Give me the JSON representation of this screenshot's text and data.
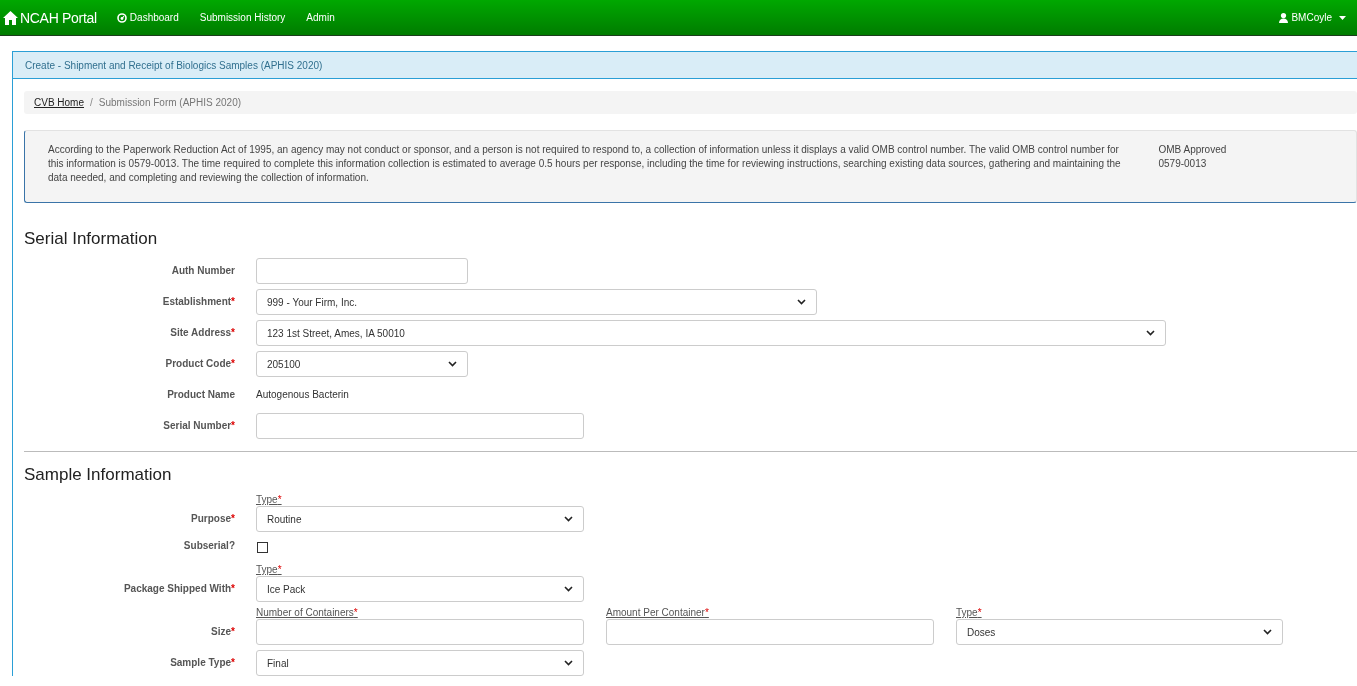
{
  "navbar": {
    "brand": "NCAH Portal",
    "items": [
      {
        "label": "Dashboard"
      },
      {
        "label": "Submission History"
      },
      {
        "label": "Admin"
      }
    ],
    "user": "BMCoyle"
  },
  "panel": {
    "title": "Create - Shipment and Receipt of Biologics Samples (APHIS 2020)",
    "breadcrumb": {
      "link": "CVB Home",
      "separator": "/",
      "current": "Submission Form (APHIS 2020)"
    },
    "notice": {
      "text": "According to the Paperwork Reduction Act of 1995, an agency may not conduct or sponsor, and a person is not required to respond to, a collection of information unless it displays a valid OMB control number. The valid OMB control number for this information is 0579-0013. The time required to complete this information collection is estimated to average 0.5 hours per response, including the time for reviewing instructions, searching existing data sources, gathering and maintaining the data needed, and completing and reviewing the collection of information.",
      "omb_label": "OMB Approved",
      "omb_number": "0579-0013"
    },
    "sections": [
      {
        "title": "Serial Information",
        "rows": [
          {
            "label": "Auth Number",
            "controls": [
              {
                "kind": "input"
              }
            ]
          },
          {
            "label": "Establishment",
            "required_mark": "*",
            "controls": [
              {
                "kind": "select",
                "value": "999 - Your Firm, Inc."
              }
            ]
          },
          {
            "label": "Site Address",
            "required_mark": "*",
            "controls": [
              {
                "kind": "select",
                "value": "123 1st Street, Ames, IA 50010"
              }
            ]
          },
          {
            "label": "Product Code",
            "required_mark": "*",
            "controls": [
              {
                "kind": "select",
                "value": "205100"
              }
            ]
          },
          {
            "label": "Product Name",
            "controls": [
              {
                "kind": "text",
                "value": "Autogenous Bacterin"
              }
            ]
          },
          {
            "label": "Serial Number",
            "required_mark": "*",
            "controls": [
              {
                "kind": "input"
              }
            ]
          }
        ]
      },
      {
        "title": "Sample Information",
        "rows": [
          {
            "label": "Purpose",
            "required_mark": "*",
            "controls": [
              {
                "kind": "select",
                "caption": "Type",
                "caption_mark": "*",
                "value": "Routine"
              }
            ]
          },
          {
            "label": "Subserial?",
            "controls": [
              {
                "kind": "checkbox",
                "checked": false
              }
            ]
          },
          {
            "label": "Package Shipped With",
            "required_mark": "*",
            "controls": [
              {
                "kind": "select",
                "caption": "Type",
                "caption_mark": "*",
                "value": "Ice Pack"
              }
            ]
          },
          {
            "label": "Size",
            "required_mark": "*",
            "controls": [
              {
                "kind": "input",
                "caption": "Number of Containers",
                "caption_mark": "*"
              },
              {
                "kind": "input",
                "caption": "Amount Per Container",
                "caption_mark": "*"
              },
              {
                "kind": "select",
                "caption": "Type",
                "caption_mark": "*",
                "value": "Doses"
              }
            ]
          },
          {
            "label": "Sample Type",
            "required_mark": "*",
            "controls": [
              {
                "kind": "select",
                "value": "Final"
              }
            ]
          }
        ]
      }
    ]
  }
}
